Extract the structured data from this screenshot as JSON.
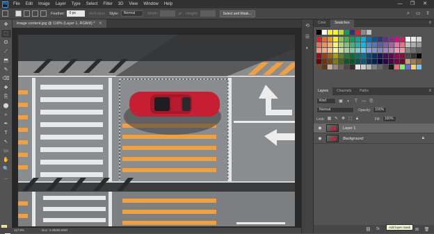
{
  "app": {
    "logo": "Ps"
  },
  "menu": [
    "File",
    "Edit",
    "Image",
    "Layer",
    "Type",
    "Select",
    "Filter",
    "3D",
    "View",
    "Window",
    "Help"
  ],
  "window_controls": [
    "—",
    "❐",
    "✕"
  ],
  "options": {
    "feather_label": "Feather:",
    "feather_value": "0 px",
    "antialias_label": "Anti-alias",
    "style_label": "Style:",
    "style_value": "Normal",
    "width_label": "Width:",
    "height_label": "Height:",
    "select_mask_label": "Select and Mask..."
  },
  "document": {
    "tab_title": "image content.jpg @ 118% (Layer 1, RGB/8) *",
    "zoom": "117.9%",
    "doc_size": "Doc: 3.30M/6.60M"
  },
  "panels": {
    "color_tab": "Color",
    "swatches_tab": "Swatches",
    "layers_tab": "Layers",
    "channels_tab": "Channels",
    "paths_tab": "Paths"
  },
  "swatches": {
    "recent": [
      "#000000",
      "#ffffff",
      "#fff200",
      "#ffff00",
      "#b5e61d",
      "#00a651",
      "#2e3192",
      "#ed1c24",
      "#8c8c8c",
      "#c0c0c0"
    ],
    "grid": [
      "#ed1c24",
      "#f26522",
      "#f7941d",
      "#fff200",
      "#8dc63f",
      "#39b54a",
      "#00a651",
      "#00a99d",
      "#00aeef",
      "#0072bc",
      "#0054a6",
      "#2e3192",
      "#662d91",
      "#92278f",
      "#ec008c",
      "#ed145b",
      "#ffffff",
      "#ebebeb",
      "#d6d6d6",
      "#f26c4f",
      "#f68e55",
      "#fbaf5c",
      "#fff467",
      "#acd372",
      "#7cc576",
      "#3bb878",
      "#1abbb4",
      "#00bff3",
      "#438ccb",
      "#5574b9",
      "#605ca8",
      "#855fa8",
      "#a763a8",
      "#f06ea9",
      "#f26d7d",
      "#c2c2c2",
      "#adadad",
      "#999999",
      "#f7977a",
      "#f9ad81",
      "#fdc68a",
      "#fff79a",
      "#c4df9b",
      "#a3d39c",
      "#82ca9d",
      "#7bcdc8",
      "#6ecff6",
      "#7ea7d8",
      "#8493ca",
      "#8882be",
      "#a187be",
      "#bc8cbf",
      "#f49ac1",
      "#f5989d",
      "#858585",
      "#707070",
      "#5c5c5c",
      "#9e0b0f",
      "#a0410d",
      "#a3620a",
      "#aba000",
      "#598527",
      "#1a7b30",
      "#007236",
      "#00746b",
      "#0076a3",
      "#004b80",
      "#003471",
      "#1b1464",
      "#440e62",
      "#630460",
      "#9e005d",
      "#9e0039",
      "#474747",
      "#333333",
      "#000000",
      "#790000",
      "#7b2e00",
      "#7d4900",
      "#827b00",
      "#406618",
      "#005e20",
      "#005826",
      "#005952",
      "#005b7f",
      "#003663",
      "#002157",
      "#0d004c",
      "#32004b",
      "#4b0049",
      "#7b0046",
      "#7a0026",
      "#c69c6d",
      "#a67c52",
      "#8c6239",
      "#754c24",
      "#603913",
      "#c7b299",
      "#998675",
      "#736357",
      "#534741",
      "#362f2d",
      "#e6e6e6",
      "#cccccc",
      "#b3b3b3",
      "#808080",
      "#666666",
      "#4d4d4d",
      "#1a1a1a",
      "#ff6666",
      "#66ff66",
      "#6666ff",
      "#ffcc66",
      "#66ccff"
    ]
  },
  "layers": {
    "kind_label": "Kind",
    "blend_mode": "Normal",
    "opacity_label": "Opacity:",
    "opacity_value": "100%",
    "lock_label": "Lock:",
    "fill_label": "Fill:",
    "fill_value": "100%",
    "items": [
      {
        "name": "Layer 1",
        "selected": true
      },
      {
        "name": "Background",
        "selected": false,
        "locked": true
      }
    ],
    "tooltip": "Add layer mask"
  },
  "tools": [
    "✥",
    "⬚",
    "ʘ",
    "⟋",
    "⬒",
    "✎",
    "⌫",
    "✚",
    "⎘",
    "⬤",
    "⌕",
    "✒",
    "T",
    "↖",
    "▭",
    "✋",
    "🔍",
    "…"
  ]
}
